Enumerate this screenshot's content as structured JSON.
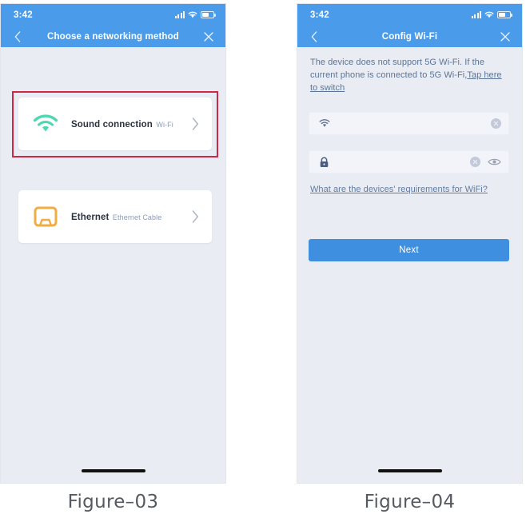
{
  "figures": [
    {
      "caption": "Figure–03",
      "statusbar": {
        "time": "3:42",
        "signal_icon": "signal-bars-icon",
        "wifi_icon": "wifi-icon",
        "battery_icon": "battery-icon"
      },
      "navbar": {
        "back_icon": "chevron-left-icon",
        "title": "Choose a networking method",
        "close_icon": "close-icon"
      },
      "cards": [
        {
          "icon": "wifi-icon",
          "icon_color": "#4ed8b2",
          "title": "Sound connection",
          "subtitle": "Wi-Fi",
          "chevron": "chevron-right-icon",
          "highlighted": true
        },
        {
          "icon": "ethernet-port-icon",
          "icon_color": "#f0ad43",
          "title": "Ethernet",
          "subtitle": "Ethernet Cable",
          "chevron": "chevron-right-icon",
          "highlighted": false
        }
      ],
      "highlight_color": "#cf2846"
    },
    {
      "caption": "Figure–04",
      "statusbar": {
        "time": "3:42",
        "signal_icon": "signal-bars-icon",
        "wifi_icon": "wifi-icon",
        "battery_icon": "battery-icon"
      },
      "navbar": {
        "back_icon": "chevron-left-icon",
        "title": "Config Wi-Fi",
        "close_icon": "close-icon"
      },
      "notice": {
        "text": "The device does not support 5G Wi-Fi. If the current phone is connected to 5G Wi-Fi,",
        "link_text": "Tap here to switch"
      },
      "fields": [
        {
          "name": "ssid",
          "icon": "wifi-icon",
          "value": "",
          "placeholder": "",
          "clear_icon": "clear-circle-icon"
        },
        {
          "name": "password",
          "icon": "lock-icon",
          "value": "",
          "placeholder": "",
          "clear_icon": "clear-circle-icon",
          "reveal_icon": "eye-icon"
        }
      ],
      "requirements_link": "What are the devices' requirements for WiFi?",
      "next_label": "Next",
      "accent_color": "#3e8fe0"
    }
  ]
}
